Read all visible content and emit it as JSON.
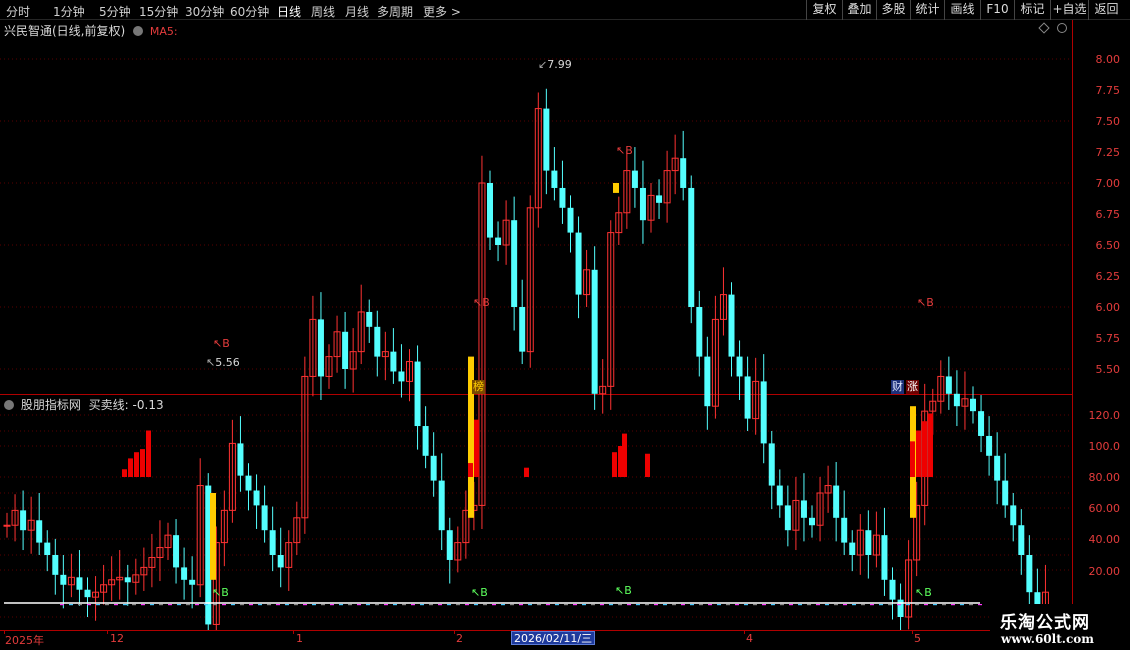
{
  "toolbar": {
    "periods": [
      "分时",
      "1分钟",
      "5分钟",
      "15分钟",
      "30分钟",
      "60分钟",
      "日线",
      "周线",
      "月线",
      "多周期",
      "更多 >"
    ],
    "active_period": "日线",
    "right_buttons": [
      "复权",
      "叠加",
      "多股",
      "统计",
      "画线",
      "F10",
      "标记",
      "+自选",
      "返回"
    ]
  },
  "main_panel": {
    "title": "兴民智通(日线,前复权)",
    "indicator": "MA5:",
    "y_labels": [
      "8.00",
      "7.75",
      "7.50",
      "7.25",
      "7.00",
      "6.75",
      "6.50",
      "6.25",
      "6.00",
      "5.75",
      "5.50"
    ],
    "high_label": "7.99",
    "low_label": "5.56",
    "buy_signal": "B",
    "tags": [
      "榜",
      "财",
      "涨"
    ]
  },
  "indicator_panel": {
    "title": "股朋指标网",
    "line_name": "买卖线:",
    "line_value": "-0.13",
    "y_labels": [
      "120.0",
      "100.0",
      "80.00",
      "60.00",
      "40.00",
      "20.00"
    ],
    "buy_signal": "B"
  },
  "x_axis": {
    "labels": [
      "2025年",
      "12",
      "1",
      "2",
      "4",
      "5"
    ],
    "cursor_date": "2026/02/11/三"
  },
  "logo": {
    "name": "乐淘公式网",
    "url": "www.60lt.com"
  },
  "colors": {
    "up": "#ff3232",
    "down": "#54ffff",
    "signal": "#ffcc00",
    "axis": "#b00000",
    "bars": "#ee0000"
  }
}
